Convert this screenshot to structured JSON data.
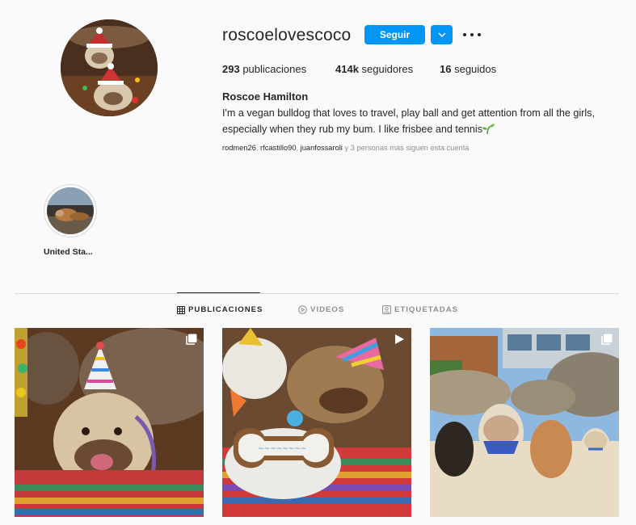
{
  "profile": {
    "username": "roscoelovescoco",
    "follow_label": "Seguir",
    "stats": [
      {
        "count": "293",
        "label": "publicaciones"
      },
      {
        "count": "414k",
        "label": "seguidores"
      },
      {
        "count": "16",
        "label": "seguidos"
      }
    ],
    "full_name": "Roscoe Hamilton",
    "bio_line1": "I'm a vegan bulldog that loves to travel, play ball and get attention from all the girls,",
    "bio_line2": "especially when they rub my bum. I like frisbee and tennis",
    "followed_by": {
      "users": [
        "rodmen26",
        "rfcastillo90",
        "juanfossaroli"
      ],
      "sep1": ", ",
      "sep2": ", ",
      "suffix": " y 3 personas más siguen esta cuenta"
    }
  },
  "highlights": [
    {
      "label": "United Sta..."
    }
  ],
  "tabs": [
    {
      "label": "PUBLICACIONES",
      "icon": "grid-icon",
      "active": true
    },
    {
      "label": "VIDEOS",
      "icon": "play-circle-icon",
      "active": false
    },
    {
      "label": "ETIQUETADAS",
      "icon": "tag-icon",
      "active": false
    }
  ],
  "posts": [
    {
      "badge": "carousel-icon",
      "subject": "bulldog with party hat"
    },
    {
      "badge": "video-icon",
      "subject": "bulldogs with bone-shaped cake"
    },
    {
      "badge": "carousel-icon",
      "subject": "four dogs on the beach"
    }
  ],
  "colors": {
    "accent": "#0095f6",
    "text": "#262626",
    "muted": "#8e8e8e",
    "divider": "#dbdbdb",
    "background": "#fafafa"
  }
}
